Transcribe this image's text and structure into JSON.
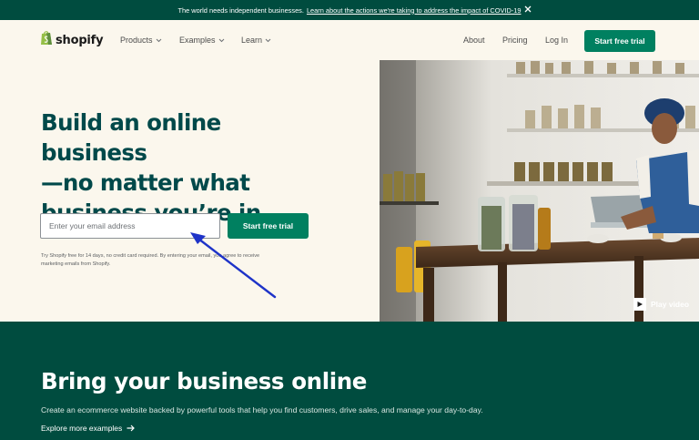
{
  "announcement": {
    "text": "The world needs independent businesses.",
    "link": "Learn about the actions we're taking to address the impact of COVID-19"
  },
  "nav": {
    "logo": "shopify",
    "items": [
      {
        "label": "Products"
      },
      {
        "label": "Examples"
      },
      {
        "label": "Learn"
      }
    ],
    "right_links": [
      {
        "label": "About"
      },
      {
        "label": "Pricing"
      },
      {
        "label": "Log In"
      }
    ],
    "cta": "Start free trial"
  },
  "hero": {
    "title_lines": [
      "Build an online business",
      "—no matter what",
      "business you’re in"
    ],
    "email_placeholder": "Enter your email address",
    "cta": "Start free trial",
    "disclaimer_lines": [
      "Try Shopify free for 14 days, no credit card required. By entering your email, you agree to receive",
      "marketing emails from Shopify."
    ],
    "video_label": "Play video"
  },
  "lower": {
    "title": "Bring your business online",
    "subtitle": "Create an ecommerce website backed by powerful tools that help you find customers, drive sales, and manage your day-to-day.",
    "link": "Explore more examples"
  },
  "colors": {
    "brand_green": "#008060",
    "dark_green": "#004c3f",
    "hero_text": "#00494a",
    "cream": "#fbf7ed",
    "annotation_arrow": "#1e33c8"
  }
}
